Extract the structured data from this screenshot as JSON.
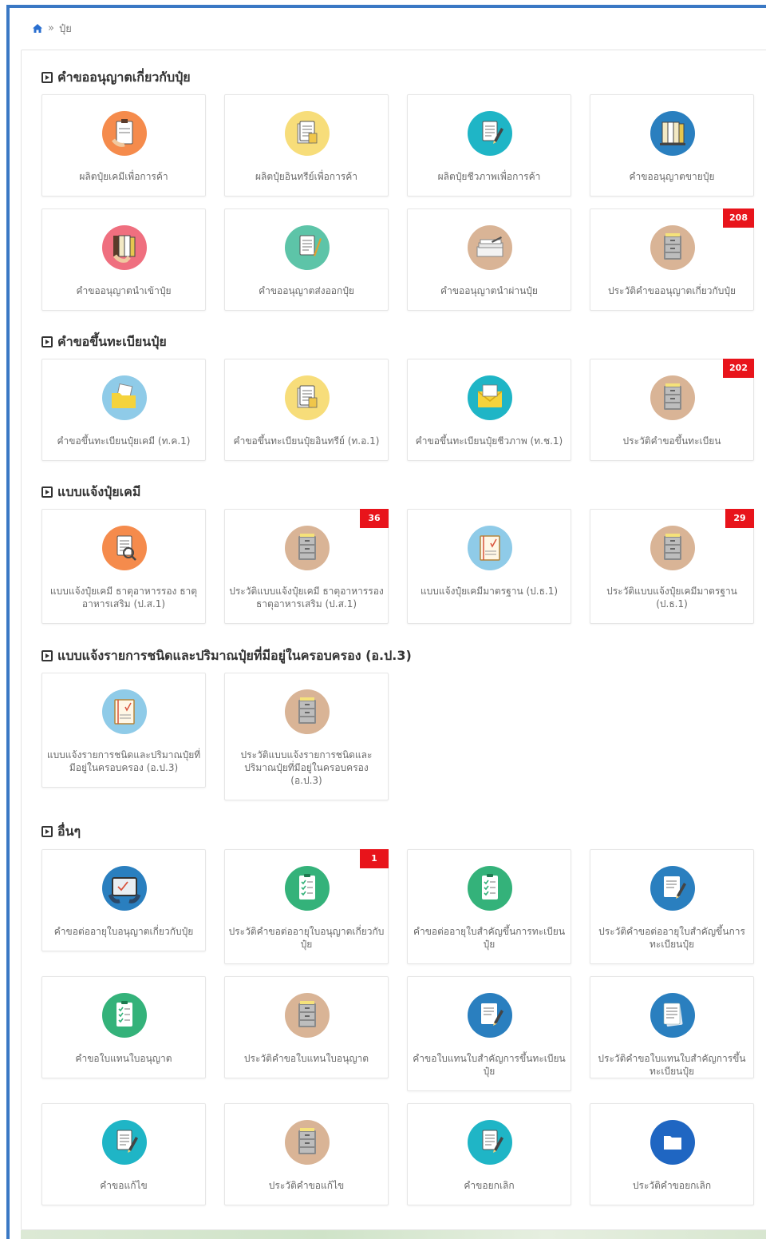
{
  "breadcrumb": {
    "home_icon": "home-icon",
    "separator": "»",
    "current": "ปุ๋ย"
  },
  "colors": {
    "accent": "#3a78c4",
    "badge": "#e8141b",
    "orange": "#f58b4c",
    "yellow": "#f7dd7a",
    "teal": "#1fb5c6",
    "blue": "#2a7fbf",
    "pink": "#ef6f7f",
    "green": "#5dc4a8",
    "tan": "#d9b496",
    "lightblue": "#8fcbe8",
    "darkblue": "#1f66c2"
  },
  "sections": [
    {
      "title": "คำขออนุญาตเกี่ยวกับปุ๋ย",
      "tiles": [
        {
          "label": "ผลิตปุ๋ยเคมีเพื่อการค้า",
          "icon": "clipboard-hand-icon",
          "color": "#f58b4c"
        },
        {
          "label": "ผลิตปุ๋ยอินทรีย์เพื่อการค้า",
          "icon": "document-stack-icon",
          "color": "#f7dd7a"
        },
        {
          "label": "ผลิตปุ๋ยชีวภาพเพื่อการค้า",
          "icon": "document-pen-icon",
          "color": "#1fb5c6"
        },
        {
          "label": "คำขออนุญาตขายปุ๋ย",
          "icon": "binders-icon",
          "color": "#2a7fbf"
        }
      ]
    },
    {
      "title": "",
      "tiles": [
        {
          "label": "คำขออนุญาตนำเข้าปุ๋ย",
          "icon": "binders-hand-icon",
          "color": "#ef6f7f"
        },
        {
          "label": "คำขออนุญาตส่งออกปุ๋ย",
          "icon": "document-pencil-icon",
          "color": "#5dc4a8"
        },
        {
          "label": "คำขออนุญาตนำผ่านปุ๋ย",
          "icon": "paper-pile-icon",
          "color": "#d9b496"
        },
        {
          "label": "ประวัติคำขออนุญาตเกี่ยวกับปุ๋ย",
          "icon": "cabinet-icon",
          "color": "#d9b496",
          "badge": "208"
        }
      ]
    },
    {
      "title": "คำขอขึ้นทะเบียนปุ๋ย",
      "tiles": [
        {
          "label": "คำขอขึ้นทะเบียนปุ๋ยเคมี (ท.ค.1)",
          "icon": "folder-docs-icon",
          "color": "#8fcbe8"
        },
        {
          "label": "คำขอขึ้นทะเบียนปุ๋ยอินทรีย์ (ท.อ.1)",
          "icon": "document-stack-icon",
          "color": "#f7dd7a"
        },
        {
          "label": "คำขอขึ้นทะเบียนปุ๋ยชีวภาพ (ท.ช.1)",
          "icon": "envelope-icon",
          "color": "#1fb5c6"
        },
        {
          "label": "ประวัติคำขอขึ้นทะเบียน",
          "icon": "cabinet-icon",
          "color": "#d9b496",
          "badge": "202"
        }
      ]
    },
    {
      "title": "แบบแจ้งปุ๋ยเคมี",
      "tiles": [
        {
          "label": "แบบแจ้งปุ๋ยเคมี ธาตุอาหารรอง ธาตุอาหารเสริม (ป.ส.1)",
          "icon": "document-search-icon",
          "color": "#f58b4c"
        },
        {
          "label": "ประวัติแบบแจ้งปุ๋ยเคมี ธาตุอาหารรอง ธาตุอาหารเสริม (ป.ส.1)",
          "icon": "cabinet-icon",
          "color": "#d9b496",
          "badge": "36"
        },
        {
          "label": "แบบแจ้งปุ๋ยเคมีมาตรฐาน (ป.ธ.1)",
          "icon": "notebook-check-icon",
          "color": "#8fcbe8"
        },
        {
          "label": "ประวัติแบบแจ้งปุ๋ยเคมีมาตรฐาน (ป.ธ.1)",
          "icon": "cabinet-icon",
          "color": "#d9b496",
          "badge": "29"
        }
      ]
    },
    {
      "title": "แบบแจ้งรายการชนิดและปริมาณปุ๋ยที่มีอยู่ในครอบครอง (อ.ป.3)",
      "tiles": [
        {
          "label": "แบบแจ้งรายการชนิดและปริมาณปุ๋ยที่มีอยู่ในครอบครอง (อ.ป.3)",
          "icon": "notebook-check-icon",
          "color": "#8fcbe8"
        },
        {
          "label": "ประวัติแบบแจ้งรายการชนิดและปริมาณปุ๋ยที่มีอยู่ในครอบครอง (อ.ป.3)",
          "icon": "cabinet-icon",
          "color": "#d9b496"
        }
      ]
    },
    {
      "title": "อื่นๆ",
      "tiles": [
        {
          "label": "คำขอต่ออายุใบอนุญาตเกี่ยวกับปุ๋ย",
          "icon": "tablet-hands-icon",
          "color": "#2a7fbf"
        },
        {
          "label": "ประวัติคำขอต่ออายุใบอนุญาตเกี่ยวกับปุ๋ย",
          "icon": "checklist-icon",
          "color": "#34b27a",
          "badge": "1"
        },
        {
          "label": "คำขอต่ออายุใบสำคัญขึ้นการทะเบียนปุ๋ย",
          "icon": "checklist-icon",
          "color": "#34b27a"
        },
        {
          "label": "ประวัติคำขอต่ออายุใบสำคัญขึ้นการทะเบียนปุ๋ย",
          "icon": "document-edit-icon",
          "color": "#2a7fbf"
        }
      ]
    },
    {
      "title": "",
      "tiles": [
        {
          "label": "คำขอใบแทนใบอนุญาต",
          "icon": "checklist-icon",
          "color": "#34b27a"
        },
        {
          "label": "ประวัติคำขอใบแทนใบอนุญาต",
          "icon": "cabinet-icon",
          "color": "#d9b496"
        },
        {
          "label": "คำขอใบแทนใบสำคัญการขึ้นทะเบียนปุ๋ย",
          "icon": "document-edit-icon",
          "color": "#2a7fbf"
        },
        {
          "label": "ประวัติคำขอใบแทนใบสำคัญการขึ้นทะเบียนปุ๋ย",
          "icon": "document-lines-icon",
          "color": "#2a7fbf"
        }
      ]
    },
    {
      "title": "",
      "tiles": [
        {
          "label": "คำขอแก้ไข",
          "icon": "document-pen-icon",
          "color": "#1fb5c6"
        },
        {
          "label": "ประวัติคำขอแก้ไข",
          "icon": "cabinet-icon",
          "color": "#d9b496"
        },
        {
          "label": "คำขอยกเลิก",
          "icon": "document-pen-icon",
          "color": "#1fb5c6"
        },
        {
          "label": "ประวัติคำขอยกเลิก",
          "icon": "folder-icon",
          "color": "#1f66c2"
        }
      ]
    }
  ]
}
